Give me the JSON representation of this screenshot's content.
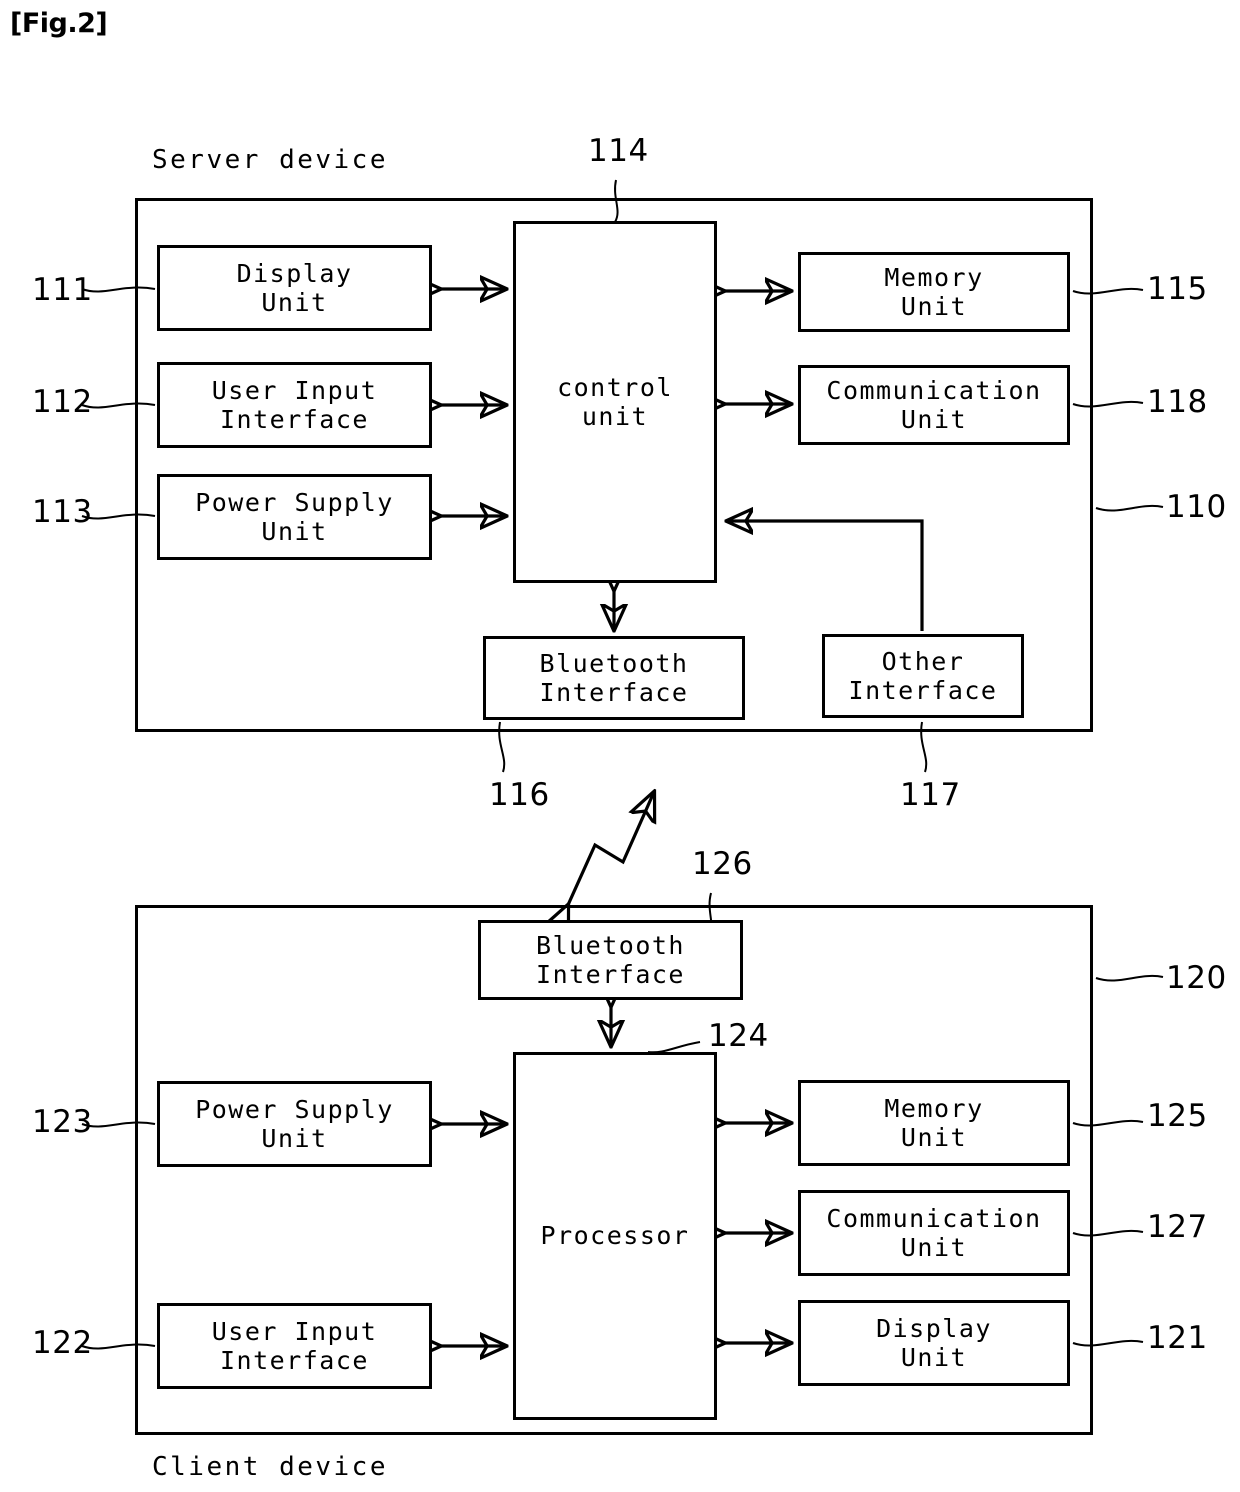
{
  "figure": {
    "label": "[Fig.2]"
  },
  "server": {
    "device_label": "Server device",
    "ref": "110",
    "left_boxes": [
      {
        "label": "Display\nUnit",
        "ref": "111"
      },
      {
        "label": "User Input\nInterface",
        "ref": "112"
      },
      {
        "label": "Power Supply\nUnit",
        "ref": "113"
      }
    ],
    "center_box": {
      "label": "control\nunit",
      "ref": "114"
    },
    "right_boxes": [
      {
        "label": "Memory\nUnit",
        "ref": "115"
      },
      {
        "label": "Communication\nUnit",
        "ref": "118"
      }
    ],
    "bottom_boxes": [
      {
        "label": "Bluetooth\nInterface",
        "ref": "116"
      },
      {
        "label": "Other\nInterface",
        "ref": "117"
      }
    ]
  },
  "client": {
    "device_label": "Client device",
    "ref": "120",
    "top_box": {
      "label": "Bluetooth\nInterface",
      "ref": "126"
    },
    "center_box": {
      "label": "Processor",
      "ref": "124"
    },
    "left_boxes": [
      {
        "label": "Power Supply\nUnit",
        "ref": "123"
      },
      {
        "label": "User Input\nInterface",
        "ref": "122"
      }
    ],
    "right_boxes": [
      {
        "label": "Memory\nUnit",
        "ref": "125"
      },
      {
        "label": "Communication\nUnit",
        "ref": "127"
      },
      {
        "label": "Display\nUnit",
        "ref": "121"
      }
    ]
  }
}
